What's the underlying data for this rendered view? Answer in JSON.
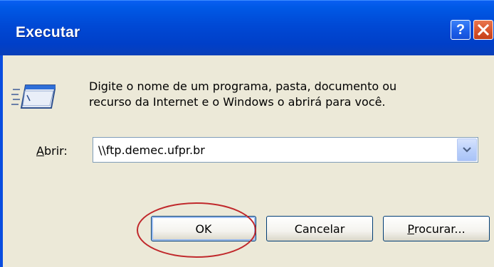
{
  "window": {
    "title": "Executar",
    "help_glyph": "?",
    "close_icon": "close-icon"
  },
  "description": {
    "line1": "Digite o nome de um programa, pasta, documento ou",
    "line2": "recurso da Internet e o Windows o abrirá para você."
  },
  "open_field": {
    "label_accel": "A",
    "label_rest": "brir:",
    "value": "\\\\ftp.demec.ufpr.br"
  },
  "buttons": {
    "ok": "OK",
    "cancel": "Cancelar",
    "browse_accel": "P",
    "browse_rest": "rocurar..."
  },
  "colors": {
    "title_bar": "#0054e3",
    "dialog_background": "#ece9d8",
    "close_button": "#d6512a",
    "highlight_ellipse": "#c0282b"
  }
}
